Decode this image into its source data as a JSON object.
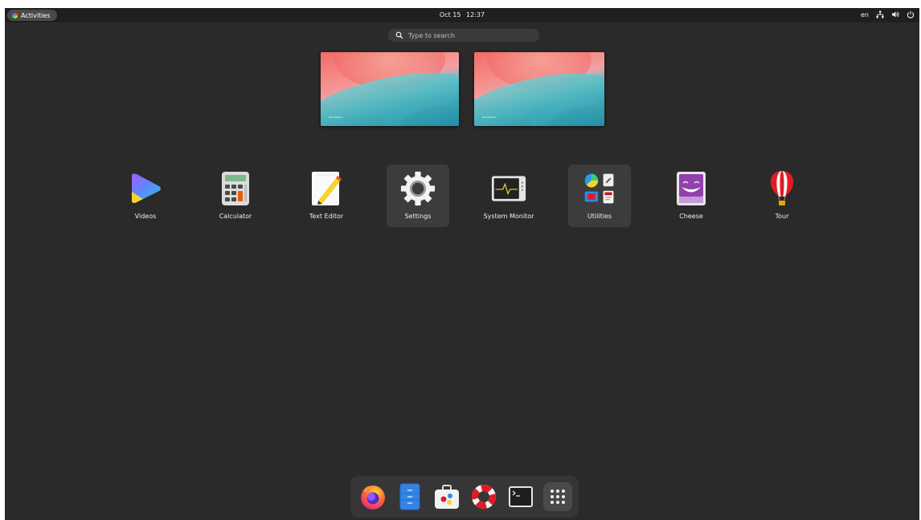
{
  "topbar": {
    "activities_label": "Activities",
    "date": "Oct 15",
    "time": "12:37",
    "language": "en"
  },
  "search": {
    "placeholder": "Type to search"
  },
  "workspaces": [
    {
      "brand_text": "Workstation"
    },
    {
      "brand_text": "Workstation"
    }
  ],
  "apps": [
    {
      "label": "Videos"
    },
    {
      "label": "Calculator"
    },
    {
      "label": "Text Editor"
    },
    {
      "label": "Settings"
    },
    {
      "label": "System Monitor"
    },
    {
      "label": "Utilities"
    },
    {
      "label": "Cheese"
    },
    {
      "label": "Tour"
    }
  ],
  "dock": {
    "items": [
      "firefox-icon",
      "files-icon",
      "software-icon",
      "help-icon",
      "terminal-icon",
      "show-apps-icon"
    ]
  },
  "colors": {
    "background": "#2a2a2a",
    "topbar": "#1f1f1f",
    "selected_tile": "#3c3c3c",
    "dock": "#363636"
  }
}
